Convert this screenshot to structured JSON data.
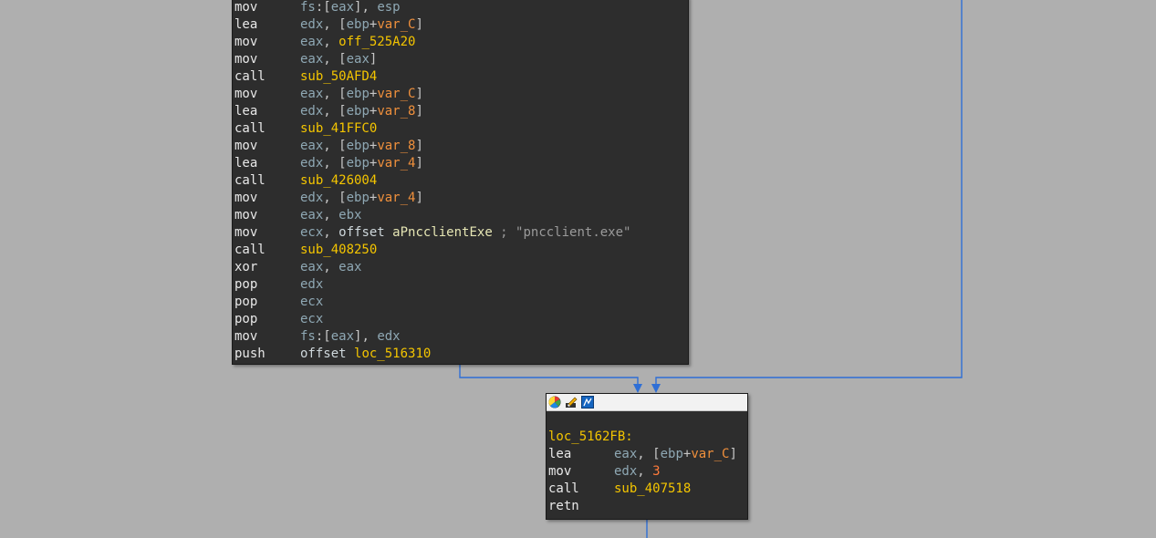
{
  "main_block": {
    "lines": [
      {
        "mnem": "mov",
        "ops": [
          [
            "reg",
            "fs"
          ],
          [
            "punct",
            ":["
          ],
          [
            "reg",
            "eax"
          ],
          [
            "punct",
            "], "
          ],
          [
            "reg",
            "esp"
          ]
        ]
      },
      {
        "mnem": "lea",
        "ops": [
          [
            "reg",
            "edx"
          ],
          [
            "punct",
            ", ["
          ],
          [
            "reg",
            "ebp"
          ],
          [
            "punct",
            "+"
          ],
          [
            "var",
            "var_C"
          ],
          [
            "punct",
            "]"
          ]
        ]
      },
      {
        "mnem": "mov",
        "ops": [
          [
            "reg",
            "eax"
          ],
          [
            "punct",
            ", "
          ],
          [
            "sym",
            "off_525A20"
          ]
        ]
      },
      {
        "mnem": "mov",
        "ops": [
          [
            "reg",
            "eax"
          ],
          [
            "punct",
            ", ["
          ],
          [
            "reg",
            "eax"
          ],
          [
            "punct",
            "]"
          ]
        ]
      },
      {
        "mnem": "call",
        "ops": [
          [
            "sym",
            "sub_50AFD4"
          ]
        ]
      },
      {
        "mnem": "mov",
        "ops": [
          [
            "reg",
            "eax"
          ],
          [
            "punct",
            ", ["
          ],
          [
            "reg",
            "ebp"
          ],
          [
            "punct",
            "+"
          ],
          [
            "var",
            "var_C"
          ],
          [
            "punct",
            "]"
          ]
        ]
      },
      {
        "mnem": "lea",
        "ops": [
          [
            "reg",
            "edx"
          ],
          [
            "punct",
            ", ["
          ],
          [
            "reg",
            "ebp"
          ],
          [
            "punct",
            "+"
          ],
          [
            "var",
            "var_8"
          ],
          [
            "punct",
            "]"
          ]
        ]
      },
      {
        "mnem": "call",
        "ops": [
          [
            "sym",
            "sub_41FFC0"
          ]
        ]
      },
      {
        "mnem": "mov",
        "ops": [
          [
            "reg",
            "eax"
          ],
          [
            "punct",
            ", ["
          ],
          [
            "reg",
            "ebp"
          ],
          [
            "punct",
            "+"
          ],
          [
            "var",
            "var_8"
          ],
          [
            "punct",
            "]"
          ]
        ]
      },
      {
        "mnem": "lea",
        "ops": [
          [
            "reg",
            "edx"
          ],
          [
            "punct",
            ", ["
          ],
          [
            "reg",
            "ebp"
          ],
          [
            "punct",
            "+"
          ],
          [
            "var",
            "var_4"
          ],
          [
            "punct",
            "]"
          ]
        ]
      },
      {
        "mnem": "call",
        "ops": [
          [
            "sym",
            "sub_426004"
          ]
        ]
      },
      {
        "mnem": "mov",
        "ops": [
          [
            "reg",
            "edx"
          ],
          [
            "punct",
            ", ["
          ],
          [
            "reg",
            "ebp"
          ],
          [
            "punct",
            "+"
          ],
          [
            "var",
            "var_4"
          ],
          [
            "punct",
            "]"
          ]
        ]
      },
      {
        "mnem": "mov",
        "ops": [
          [
            "reg",
            "eax"
          ],
          [
            "punct",
            ", "
          ],
          [
            "reg",
            "ebx"
          ]
        ]
      },
      {
        "mnem": "mov",
        "ops": [
          [
            "reg",
            "ecx"
          ],
          [
            "punct",
            ", "
          ],
          [
            "kw",
            "offset "
          ],
          [
            "sym2",
            "aPncclientExe"
          ],
          [
            "str",
            " ; \"pncclient.exe\""
          ]
        ]
      },
      {
        "mnem": "call",
        "ops": [
          [
            "sym",
            "sub_408250"
          ]
        ]
      },
      {
        "mnem": "xor",
        "ops": [
          [
            "reg",
            "eax"
          ],
          [
            "punct",
            ", "
          ],
          [
            "reg",
            "eax"
          ]
        ]
      },
      {
        "mnem": "pop",
        "ops": [
          [
            "reg",
            "edx"
          ]
        ]
      },
      {
        "mnem": "pop",
        "ops": [
          [
            "reg",
            "ecx"
          ]
        ]
      },
      {
        "mnem": "pop",
        "ops": [
          [
            "reg",
            "ecx"
          ]
        ]
      },
      {
        "mnem": "mov",
        "ops": [
          [
            "reg",
            "fs"
          ],
          [
            "punct",
            ":["
          ],
          [
            "reg",
            "eax"
          ],
          [
            "punct",
            "], "
          ],
          [
            "reg",
            "edx"
          ]
        ]
      },
      {
        "mnem": "push",
        "ops": [
          [
            "kw",
            "offset "
          ],
          [
            "sym",
            "loc_516310"
          ]
        ]
      }
    ]
  },
  "loc_block": {
    "label": "loc_5162FB:",
    "toolbar_icons": [
      "color-palette-icon",
      "edit-rename-icon",
      "graph-overview-icon"
    ],
    "lines": [
      {
        "mnem": "lea",
        "ops": [
          [
            "reg",
            "eax"
          ],
          [
            "punct",
            ", ["
          ],
          [
            "reg",
            "ebp"
          ],
          [
            "punct",
            "+"
          ],
          [
            "var",
            "var_C"
          ],
          [
            "punct",
            "]"
          ]
        ]
      },
      {
        "mnem": "mov",
        "ops": [
          [
            "reg",
            "edx"
          ],
          [
            "punct",
            ", "
          ],
          [
            "num",
            "3"
          ]
        ]
      },
      {
        "mnem": "call",
        "ops": [
          [
            "sym",
            "sub_407518"
          ]
        ]
      },
      {
        "mnem": "retn",
        "ops": []
      }
    ]
  },
  "colors": {
    "background": "#afafaf",
    "block_bg": "#2d2d2d",
    "edge": "#2f6fd6",
    "symbol": "#f4c500",
    "variable": "#f0903c",
    "register": "#8fa8b4"
  }
}
